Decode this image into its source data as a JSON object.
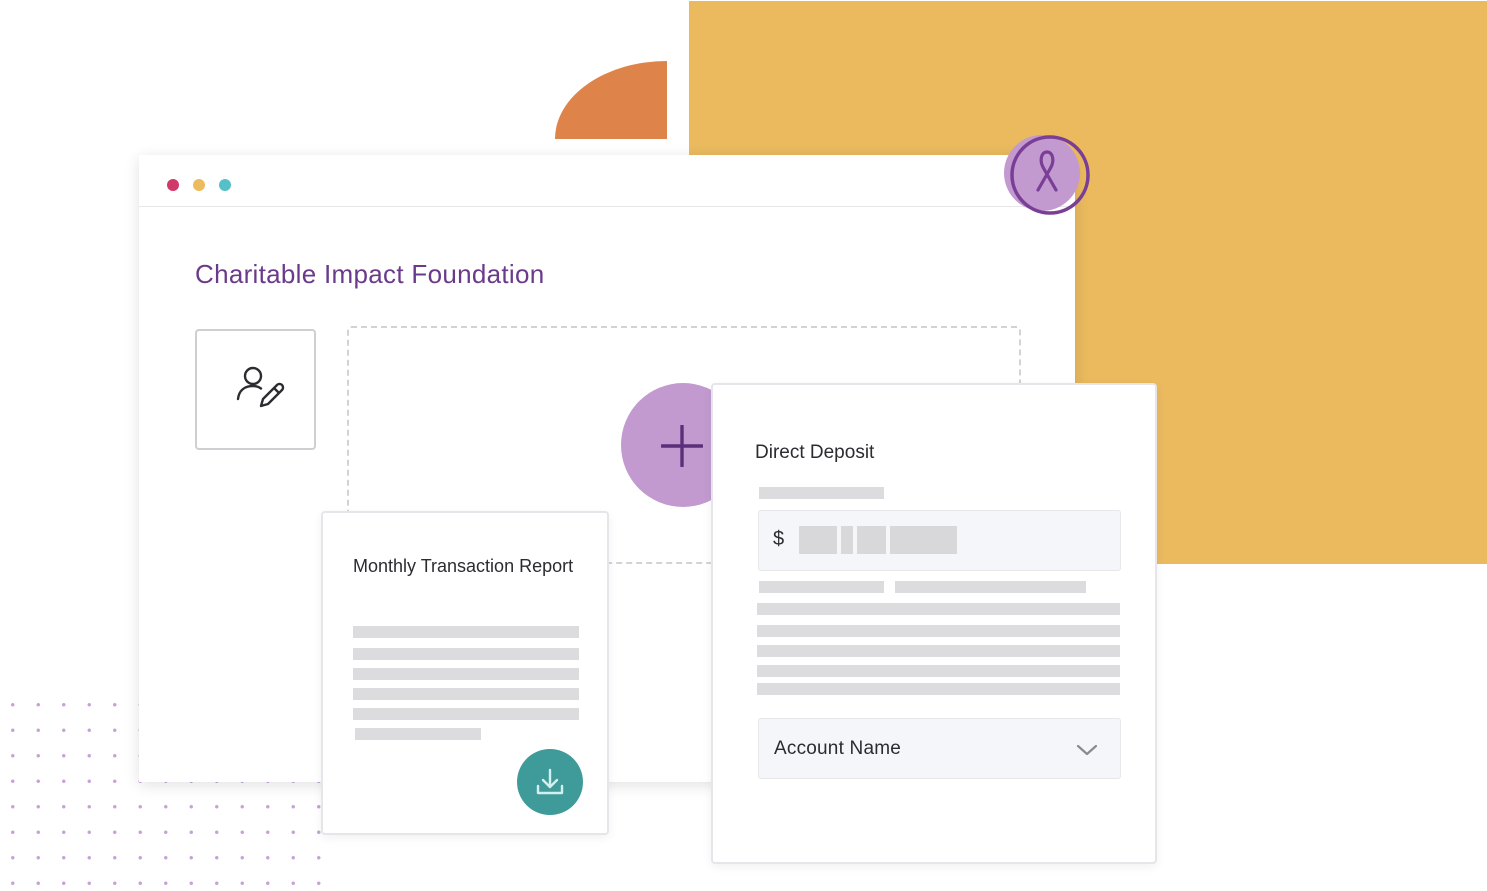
{
  "window": {
    "controls": [
      {
        "name": "close",
        "color": "#d03a6a"
      },
      {
        "name": "minimize",
        "color": "#edbb5e"
      },
      {
        "name": "zoom",
        "color": "#56c0c9"
      }
    ]
  },
  "page": {
    "title": "Charitable Impact Foundation",
    "edit_profile_icon": "user-edit-icon",
    "add_icon": "plus-icon",
    "badge_icon": "awareness-ribbon-icon"
  },
  "report_card": {
    "title": "Monthly Transaction Report",
    "download_icon": "download-icon"
  },
  "deposit_card": {
    "title": "Direct Deposit",
    "currency_symbol": "$",
    "account_select": {
      "value": "Account Name",
      "icon": "chevron-down-icon"
    }
  },
  "colors": {
    "accent_purple": "#6a3a8b",
    "light_purple": "#c29acf",
    "teal": "#3f9b9a",
    "yellow": "#ebba5f",
    "orange": "#de844a"
  }
}
